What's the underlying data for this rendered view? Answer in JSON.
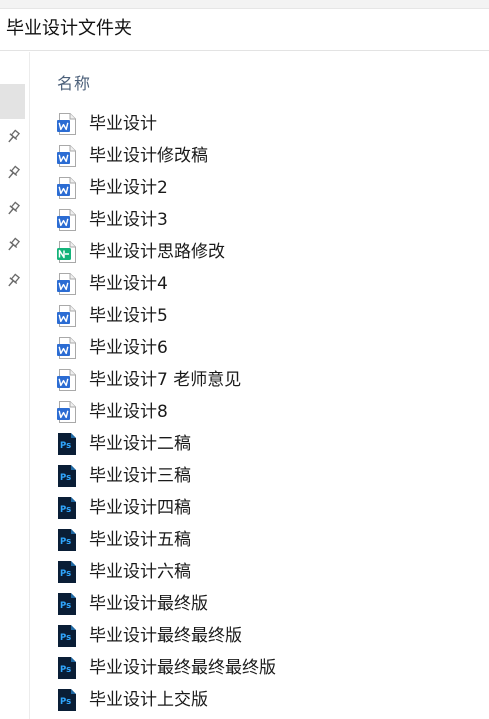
{
  "window": {
    "title": "毕业设计文件夹"
  },
  "list": {
    "column_name": "名称"
  },
  "colors": {
    "word": "#2b6cd3",
    "ps_bg": "#0a1e36",
    "ps_text": "#31a8ff",
    "mindmap": "#14b37a"
  },
  "files": [
    {
      "name": "毕业设计",
      "icon": "word-doc-icon"
    },
    {
      "name": "毕业设计修改稿",
      "icon": "word-doc-icon"
    },
    {
      "name": "毕业设计2",
      "icon": "word-doc-icon"
    },
    {
      "name": "毕业设计3",
      "icon": "word-doc-icon"
    },
    {
      "name": "毕业设计思路修改",
      "icon": "mindmap-doc-icon"
    },
    {
      "name": "毕业设计4",
      "icon": "word-doc-icon"
    },
    {
      "name": "毕业设计5",
      "icon": "word-doc-icon"
    },
    {
      "name": "毕业设计6",
      "icon": "word-doc-icon"
    },
    {
      "name": "毕业设计7 老师意见",
      "icon": "word-doc-icon"
    },
    {
      "name": "毕业设计8",
      "icon": "word-doc-icon"
    },
    {
      "name": "毕业设计二稿",
      "icon": "photoshop-file-icon"
    },
    {
      "name": "毕业设计三稿",
      "icon": "photoshop-file-icon"
    },
    {
      "name": "毕业设计四稿",
      "icon": "photoshop-file-icon"
    },
    {
      "name": "毕业设计五稿",
      "icon": "photoshop-file-icon"
    },
    {
      "name": "毕业设计六稿",
      "icon": "photoshop-file-icon"
    },
    {
      "name": "毕业设计最终版",
      "icon": "photoshop-file-icon"
    },
    {
      "name": "毕业设计最终最终版",
      "icon": "photoshop-file-icon"
    },
    {
      "name": "毕业设计最终最终最终版",
      "icon": "photoshop-file-icon"
    },
    {
      "name": "毕业设计上交版",
      "icon": "photoshop-file-icon"
    }
  ]
}
